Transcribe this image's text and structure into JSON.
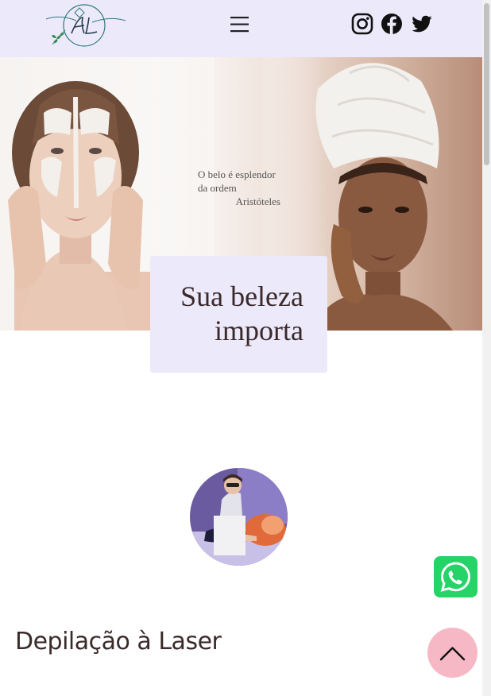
{
  "header": {
    "logo_alt": "AL",
    "menu_icon": "hamburger-icon",
    "social": [
      "instagram-icon",
      "facebook-icon",
      "twitter-icon"
    ]
  },
  "hero": {
    "quote_line1": "O belo é esplendor",
    "quote_line2": "da ordem",
    "quote_author": "Aristóteles",
    "title_line1": "Sua beleza",
    "title_line2": "importa"
  },
  "service": {
    "title": "Depilação à Laser"
  },
  "floating": {
    "whatsapp_icon": "whatsapp-icon",
    "back_to_top_icon": "chevron-up-icon"
  },
  "colors": {
    "header_bg": "#ece9fb",
    "title_text": "#3b2a2a",
    "whatsapp": "#25d366",
    "back_to_top": "#f7b8c5"
  }
}
